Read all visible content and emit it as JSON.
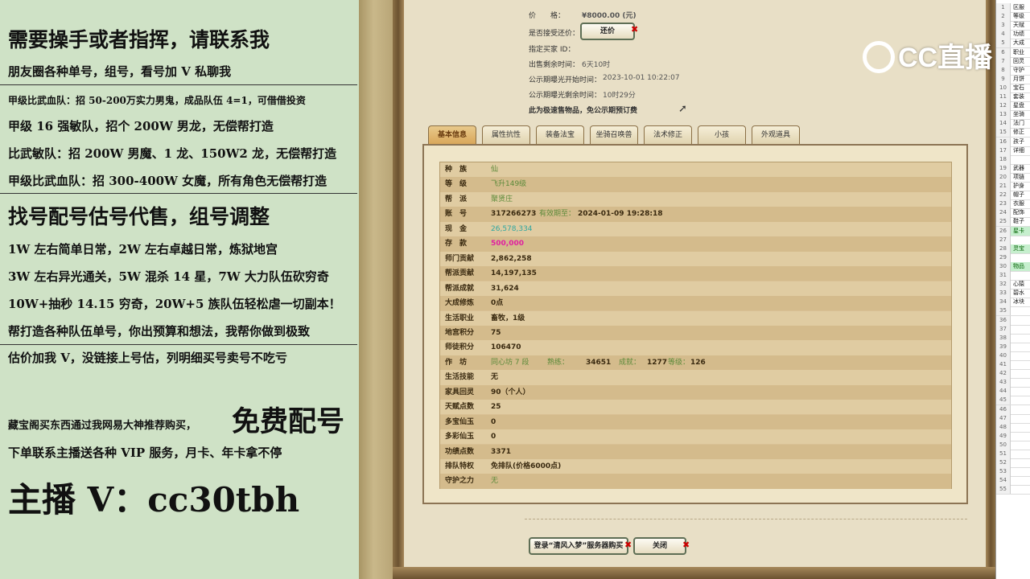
{
  "promo": {
    "line1": "需要操手或者指挥，请联系我",
    "line2": "朋友圈各种单号，组号，看号加 V 私聊我",
    "line3": "甲级比武血队：招 50-200万实力男鬼，成品队伍 4=1，可借借投资",
    "line4": "甲级 16 强敏队，招个 200W 男龙，无偿帮打造",
    "line5": "比武敏队：招 200W 男魔、1 龙、150W2 龙，无偿帮打造",
    "line6": "甲级比武血队：招 300-400W 女魔，所有角色无偿帮打造",
    "line7": "找号配号估号代售，组号调整",
    "line8": "1W 左右简单日常，2W 左右卓越日常，炼狱地宫",
    "line9": "3W 左右异光通关，5W 混杀 14 星，7W 大力队伍砍穷奇",
    "line10": "10W+抽秒 14.15 穷奇，20W+5 族队伍轻松虐一切副本！",
    "line11": "帮打造各种队伍单号，你出预算和想法，我帮你做到极致",
    "line12": "估价加我 V，没链接上号估，列明细买号卖号不吃亏",
    "line13a": "藏宝阁买东西通过我网易大神推荐购买，",
    "line13b": "免费配号",
    "line14": "下单联系主播送各种 VIP 服务，月卡、年卡拿不停",
    "line15": "主播 V：cc30tbh"
  },
  "trade": {
    "price_label": "价　　格：",
    "price_value": "¥8000.00 (元)",
    "counter_label": "是否接受还价：",
    "counter_button": "还价",
    "buyer_label": "指定买家 ID：",
    "remain_label": "出售剩余时间：",
    "remain_value": "6天10时",
    "pub_start_label": "公示期曝光开始时间：",
    "pub_start_value": "2023-10-01 10:22:07",
    "pub_remain_label": "公示期曝光剩余时间：",
    "pub_remain_value": "10时29分",
    "note": "此为极速售物品，免公示期预订费"
  },
  "tabs": [
    "基本信息",
    "属性抗性",
    "装备法宝",
    "坐骑召唤兽",
    "法术修正",
    "小孩",
    "外观道具"
  ],
  "rows": [
    {
      "k": "种　族",
      "v": "仙",
      "style": "green"
    },
    {
      "k": "等　级",
      "v": "飞升149级",
      "style": "green"
    },
    {
      "k": "帮　派",
      "v": "聚贤庄",
      "style": "green"
    },
    {
      "k": "账　号",
      "v": "317266273",
      "extra": "有效期至：",
      "extra2": "2024-01-09 19:28:18",
      "style": "dark"
    },
    {
      "k": "现　金",
      "v": "26,578,334",
      "style": "teal"
    },
    {
      "k": "存　款",
      "v": "500,000",
      "style": "pink"
    },
    {
      "k": "师门贡献",
      "v": "2,862,258",
      "style": "dark"
    },
    {
      "k": "帮派贡献",
      "v": "14,197,135",
      "style": "dark"
    },
    {
      "k": "帮派成就",
      "v": "31,624",
      "style": "dark"
    },
    {
      "k": "大成修炼",
      "v": "0点",
      "style": "dark"
    },
    {
      "k": "生活职业",
      "v": "畜牧，1级",
      "style": "dark"
    },
    {
      "k": "地宫积分",
      "v": "75",
      "style": "dark"
    },
    {
      "k": "师徒积分",
      "v": "106470",
      "style": "dark"
    },
    {
      "k": "作　坊",
      "v": "同心坊 7 段",
      "extra": "熟练：",
      "extra2": "34651",
      "extra3": "成就：",
      "extra4": "1277",
      "extra5": "等级：",
      "extra6": "126",
      "style": "green"
    },
    {
      "k": "生活技能",
      "v": "无",
      "style": "dark"
    },
    {
      "k": "家具回灵",
      "v": "90（个人）",
      "style": "dark"
    },
    {
      "k": "天赋点数",
      "v": "25",
      "style": "dark"
    },
    {
      "k": "多宝仙玉",
      "v": "0",
      "style": "dark"
    },
    {
      "k": "多彩仙玉",
      "v": "0",
      "style": "dark"
    },
    {
      "k": "功绩点数",
      "v": "3371",
      "style": "dark"
    },
    {
      "k": "排队特权",
      "v": "免排队(价格6000点)",
      "style": "dark"
    },
    {
      "k": "守护之力",
      "v": "无",
      "style": "green"
    }
  ],
  "bottom": {
    "login_button": "登录“清风入梦”服务器购买",
    "close_button": "关闭"
  },
  "watermark": "CC直播",
  "sheet": {
    "rows": [
      {
        "n": "1",
        "c": "区服"
      },
      {
        "n": "2",
        "c": "等级"
      },
      {
        "n": "3",
        "c": "天赋"
      },
      {
        "n": "4",
        "c": "功绩"
      },
      {
        "n": "5",
        "c": "大成"
      },
      {
        "n": "6",
        "c": "职业"
      },
      {
        "n": "7",
        "c": "回灵"
      },
      {
        "n": "8",
        "c": "守护"
      },
      {
        "n": "9",
        "c": "月饼"
      },
      {
        "n": "10",
        "c": "宝石"
      },
      {
        "n": "11",
        "c": "套装"
      },
      {
        "n": "12",
        "c": "星盘"
      },
      {
        "n": "13",
        "c": "坐骑"
      },
      {
        "n": "14",
        "c": "法门"
      },
      {
        "n": "15",
        "c": "修正"
      },
      {
        "n": "16",
        "c": "孩子"
      },
      {
        "n": "17",
        "c": "详细"
      },
      {
        "n": "18",
        "c": ""
      },
      {
        "n": "19",
        "c": "武器"
      },
      {
        "n": "20",
        "c": "项链"
      },
      {
        "n": "21",
        "c": "护身"
      },
      {
        "n": "22",
        "c": "帽子"
      },
      {
        "n": "23",
        "c": "衣服"
      },
      {
        "n": "24",
        "c": "配饰"
      },
      {
        "n": "25",
        "c": "鞋子"
      },
      {
        "n": "26",
        "c": "星卡"
      },
      {
        "n": "27",
        "c": ""
      },
      {
        "n": "28",
        "c": "灵宝"
      },
      {
        "n": "29",
        "c": ""
      },
      {
        "n": "30",
        "c": "物品"
      },
      {
        "n": "31",
        "c": ""
      },
      {
        "n": "32",
        "c": "心猿"
      },
      {
        "n": "33",
        "c": "碧水"
      },
      {
        "n": "34",
        "c": "冰块"
      },
      {
        "n": "35",
        "c": ""
      },
      {
        "n": "36",
        "c": ""
      },
      {
        "n": "37",
        "c": ""
      },
      {
        "n": "38",
        "c": ""
      },
      {
        "n": "39",
        "c": ""
      },
      {
        "n": "40",
        "c": ""
      },
      {
        "n": "41",
        "c": ""
      },
      {
        "n": "42",
        "c": ""
      },
      {
        "n": "43",
        "c": ""
      },
      {
        "n": "44",
        "c": ""
      },
      {
        "n": "45",
        "c": ""
      },
      {
        "n": "46",
        "c": ""
      },
      {
        "n": "47",
        "c": ""
      },
      {
        "n": "48",
        "c": ""
      },
      {
        "n": "49",
        "c": ""
      },
      {
        "n": "50",
        "c": ""
      },
      {
        "n": "51",
        "c": ""
      },
      {
        "n": "52",
        "c": ""
      },
      {
        "n": "53",
        "c": ""
      },
      {
        "n": "54",
        "c": ""
      },
      {
        "n": "55",
        "c": ""
      }
    ],
    "highlight": [
      "26",
      "28",
      "30"
    ]
  }
}
